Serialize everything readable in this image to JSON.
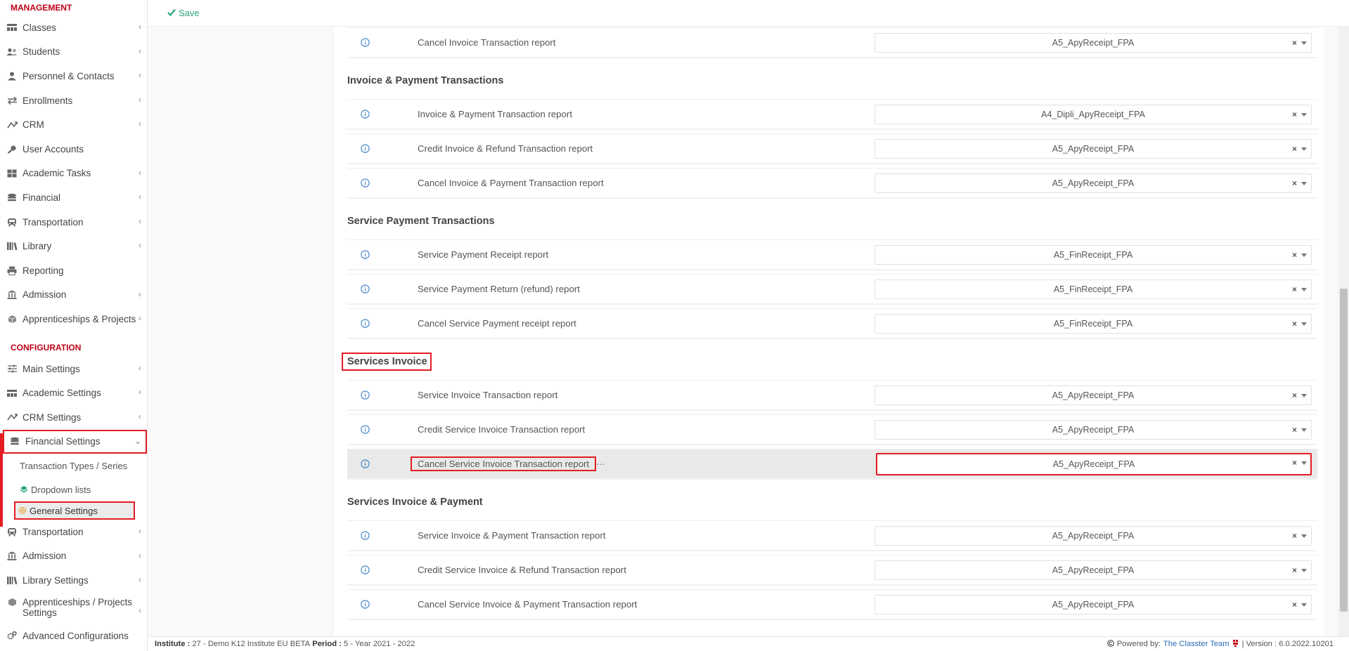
{
  "sidebar": {
    "management_header": "MANAGEMENT",
    "management_items": [
      {
        "label": "Classes",
        "icon": "classes-icon"
      },
      {
        "label": "Students",
        "icon": "students-icon"
      },
      {
        "label": "Personnel & Contacts",
        "icon": "personnel-icon"
      },
      {
        "label": "Enrollments",
        "icon": "enrollments-icon"
      },
      {
        "label": "CRM",
        "icon": "crm-icon"
      },
      {
        "label": "User Accounts",
        "icon": "key-icon"
      },
      {
        "label": "Academic Tasks",
        "icon": "grid-icon"
      },
      {
        "label": "Financial",
        "icon": "coins-icon"
      },
      {
        "label": "Transportation",
        "icon": "bus-icon"
      },
      {
        "label": "Library",
        "icon": "books-icon"
      },
      {
        "label": "Reporting",
        "icon": "printer-icon"
      },
      {
        "label": "Admission",
        "icon": "bank-icon"
      },
      {
        "label": "Apprenticeships & Projects",
        "icon": "box-icon"
      }
    ],
    "configuration_header": "CONFIGURATION",
    "configuration_items": [
      {
        "label": "Main Settings",
        "icon": "sliders-icon"
      },
      {
        "label": "Academic Settings",
        "icon": "classes-icon"
      },
      {
        "label": "CRM Settings",
        "icon": "crm-icon"
      }
    ],
    "financial_settings": "Financial Settings",
    "financial_sub": {
      "transaction_types": "Transaction Types / Series",
      "dropdown_lists": "Dropdown lists",
      "general_settings": "General Settings"
    },
    "after_items": [
      {
        "label": "Transportation",
        "icon": "bus-icon"
      },
      {
        "label": "Admission",
        "icon": "bank-icon"
      },
      {
        "label": "Library Settings",
        "icon": "books-icon"
      }
    ],
    "apprenticeships_settings": "Apprenticeships / Projects Settings",
    "advanced_configurations": "Advanced Configurations"
  },
  "toolbar": {
    "save_label": "Save"
  },
  "groups": [
    {
      "title": "",
      "rows": [
        {
          "label": "Cancel Invoice Transaction report",
          "value": "A5_ApyReceipt_FPA"
        }
      ]
    },
    {
      "title": "Invoice & Payment Transactions",
      "rows": [
        {
          "label": "Invoice & Payment Transaction report",
          "value": "A4_Dipli_ApyReceipt_FPA"
        },
        {
          "label": "Credit Invoice & Refund Transaction report",
          "value": "A5_ApyReceipt_FPA"
        },
        {
          "label": "Cancel Invoice & Payment Transaction report",
          "value": "A5_ApyReceipt_FPA"
        }
      ]
    },
    {
      "title": "Service Payment Transactions",
      "rows": [
        {
          "label": "Service Payment Receipt report",
          "value": "A5_FinReceipt_FPA"
        },
        {
          "label": "Service Payment Return (refund) report",
          "value": "A5_FinReceipt_FPA"
        },
        {
          "label": "Cancel Service Payment receipt report",
          "value": "A5_FinReceipt_FPA"
        }
      ]
    },
    {
      "title": "Services Invoice",
      "rows": [
        {
          "label": "Service Invoice Transaction report",
          "value": "A5_ApyReceipt_FPA"
        },
        {
          "label": "Credit Service Invoice Transaction report",
          "value": "A5_ApyReceipt_FPA"
        },
        {
          "label": "Cancel Service Invoice Transaction report",
          "value": "A5_ApyReceipt_FPA"
        }
      ]
    },
    {
      "title": "Services Invoice & Payment",
      "rows": [
        {
          "label": "Service Invoice & Payment Transaction report",
          "value": "A5_ApyReceipt_FPA"
        },
        {
          "label": "Credit Service Invoice & Refund Transaction report",
          "value": "A5_ApyReceipt_FPA"
        },
        {
          "label": "Cancel Service Invoice & Payment Transaction report",
          "value": "A5_ApyReceipt_FPA"
        }
      ]
    }
  ],
  "selected_row_dots": "⋯",
  "footer": {
    "institute_label": "Institute :",
    "institute_value": "27 - Demo K12 Institute EU BETA",
    "period_label": "Period :",
    "period_value": "5 - Year 2021 - 2022",
    "powered_by": "Powered by:",
    "powered_link": "The Classter Team",
    "version": "| Version : 6.0.2022.10201"
  },
  "colors": {
    "accent_red": "#c00018",
    "highlight": "#e41c24",
    "save_green": "#28a47c",
    "info_blue": "#3b7fc4"
  }
}
